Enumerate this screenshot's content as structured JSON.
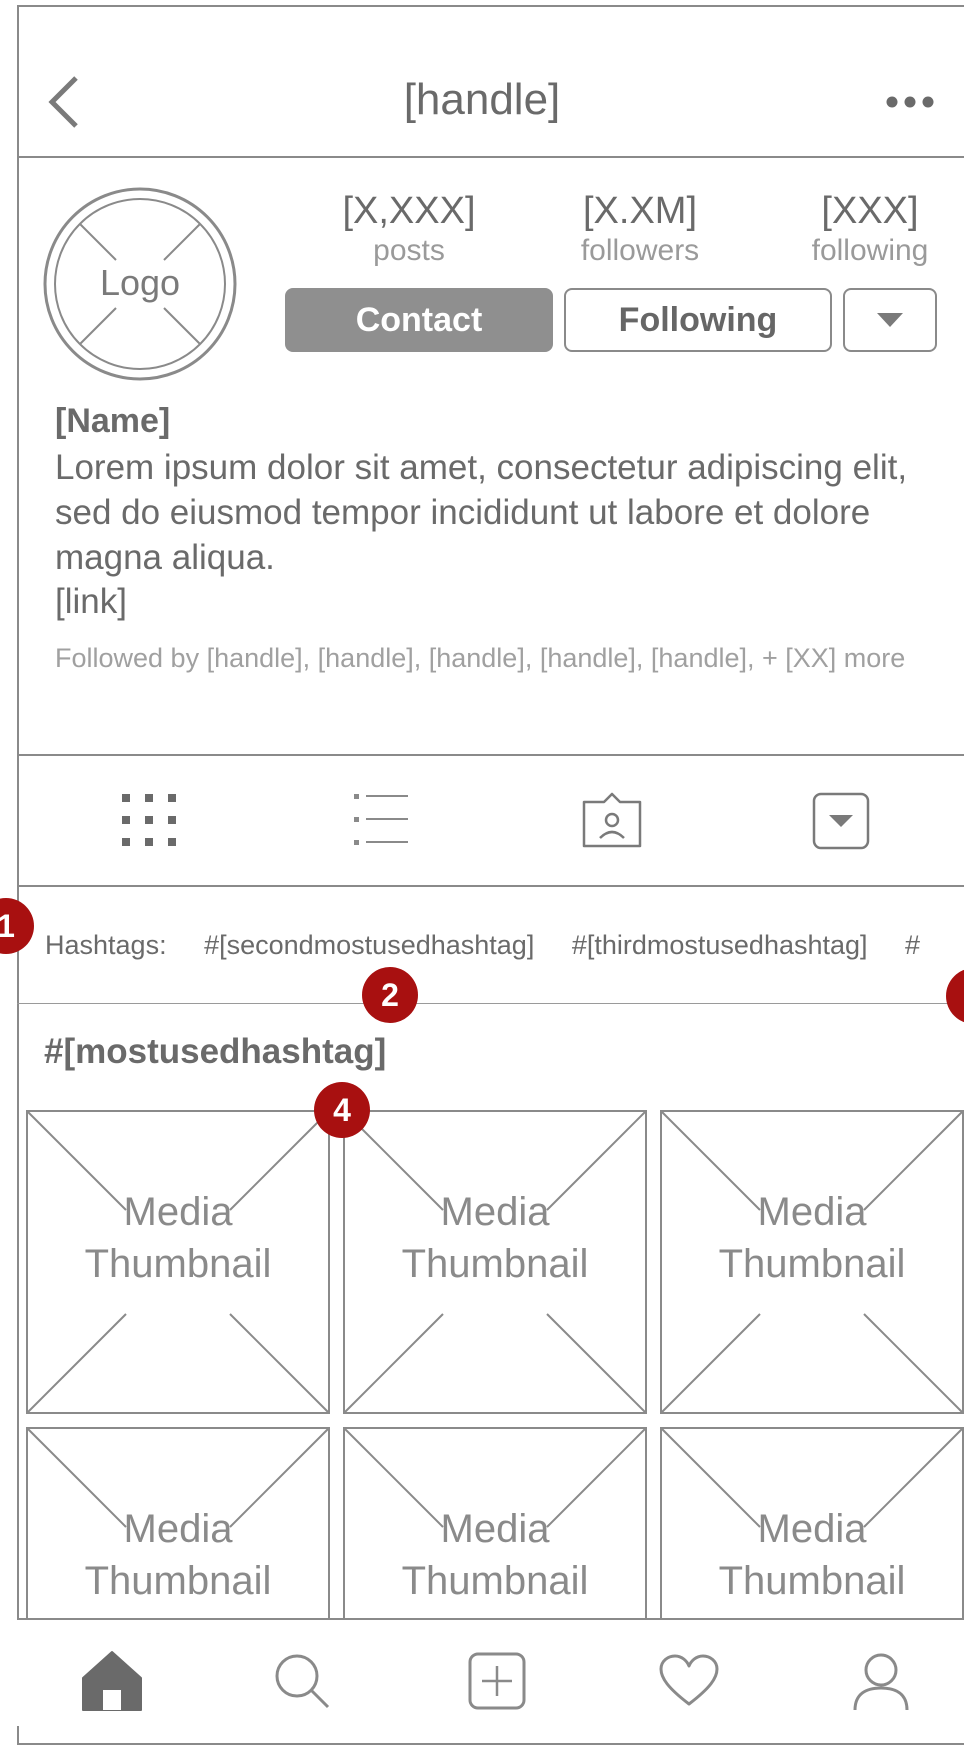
{
  "header": {
    "title": "[handle]"
  },
  "profile": {
    "logo_label": "Logo",
    "stats": [
      {
        "value": "[X,XXX]",
        "label": "posts"
      },
      {
        "value": "[X.XM]",
        "label": "followers"
      },
      {
        "value": "[XXX]",
        "label": "following"
      }
    ],
    "contact_label": "Contact",
    "following_label": "Following",
    "name": "[Name]",
    "bio": "Lorem ipsum dolor sit amet, consectetur adipiscing elit, sed do eiusmod tempor incididunt ut labore et dolore magna aliqua.",
    "link": "[link]",
    "followed_by": "Followed by [handle], [handle], [handle], [handle], [handle], + [XX] more"
  },
  "hashtag_bar": {
    "label": "Hashtags:",
    "tags": [
      "#[secondmostusedhashtag]",
      "#[thirdmostusedhashtag]",
      "#"
    ]
  },
  "section": {
    "title": "#[mostusedhashtag]"
  },
  "thumbnails": [
    {
      "line1": "Media",
      "line2": "Thumbnail"
    },
    {
      "line1": "Media",
      "line2": "Thumbnail"
    },
    {
      "line1": "Media",
      "line2": "Thumbnail"
    },
    {
      "line1": "Media",
      "line2": "Thumbnail"
    },
    {
      "line1": "Media",
      "line2": "Thumbnail"
    },
    {
      "line1": "Media",
      "line2": "Thumbnail"
    }
  ],
  "markers": [
    "1",
    "2",
    "4"
  ],
  "colors": {
    "line": "#8a8a8a",
    "marker": "#a81010",
    "button_fill": "#8f8f8f"
  },
  "icons": {
    "header": [
      "back-arrow-icon",
      "more-dots-icon"
    ],
    "tabs": [
      "grid-view-icon",
      "list-view-icon",
      "tagged-photos-icon",
      "dropdown-icon"
    ],
    "bottom_nav": [
      "home-icon",
      "search-icon",
      "add-post-icon",
      "heart-icon",
      "profile-icon"
    ]
  }
}
